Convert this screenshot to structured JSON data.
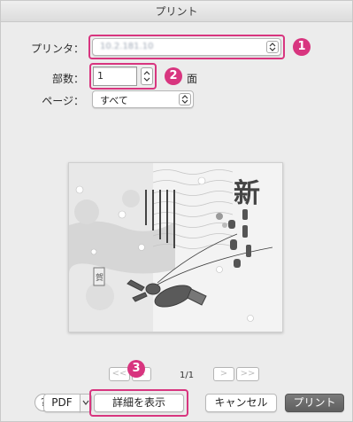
{
  "window": {
    "title": "プリント"
  },
  "printer": {
    "label": "プリンタ：",
    "value": "10.2.181.10"
  },
  "copies": {
    "label": "部数：",
    "value": "1",
    "unit": "面"
  },
  "pages": {
    "label": "ページ：",
    "value": "すべて"
  },
  "preview": {
    "heading_big": "新",
    "heading_rest": "春のお慶びを申し上げます",
    "message_lines": [
      "輝かしい新年をお迎えのことと",
      "皆様のご多幸を心より",
      "お祈り申し上げます",
      "本年もよろしく",
      "お願いいたします"
    ],
    "stamp": "賀"
  },
  "pager": {
    "indicator": "1/1",
    "first": "<<",
    "prev": "<",
    "next": ">",
    "last": ">>"
  },
  "footer": {
    "help": "?",
    "pdf": "PDF",
    "details": "詳細を表示",
    "cancel": "キャンセル",
    "print": "プリント"
  },
  "annotations": {
    "one": "1",
    "two": "2",
    "three": "3"
  },
  "colors": {
    "accent": "#d8357f",
    "primary_button": "#6b6b6b"
  }
}
